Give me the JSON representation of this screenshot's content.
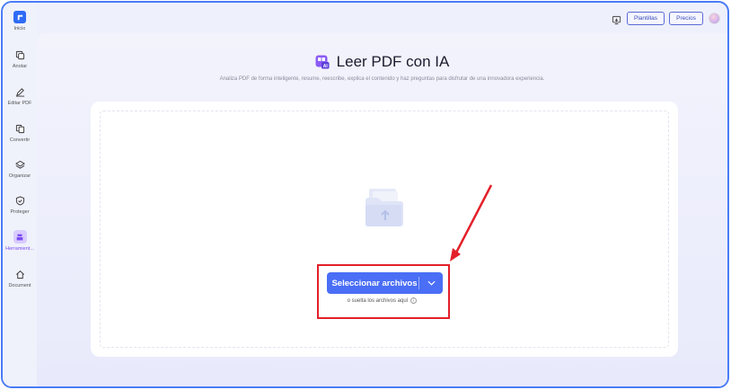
{
  "sidebar": {
    "items": [
      {
        "label": "Inicio"
      },
      {
        "label": "Anotar"
      },
      {
        "label": "Editar PDF"
      },
      {
        "label": "Convertir"
      },
      {
        "label": "Organizar"
      },
      {
        "label": "Proteger"
      },
      {
        "label": "Herramient..."
      },
      {
        "label": "Document"
      }
    ]
  },
  "topbar": {
    "templates_label": "Plantillas",
    "pricing_label": "Precios"
  },
  "main": {
    "title": "Leer PDF con IA",
    "subtitle": "Analiza PDF de forma inteligente, resume, reescribe, explica el contenido y haz preguntas para disfrutar de una innovadora experiencia.",
    "select_button_label": "Seleccionar archivos",
    "drop_hint": "o suelta los archivos aquí"
  },
  "colors": {
    "accent": "#4a6ef5",
    "frame": "#4a7cf7",
    "annotation": "#e3202a"
  }
}
